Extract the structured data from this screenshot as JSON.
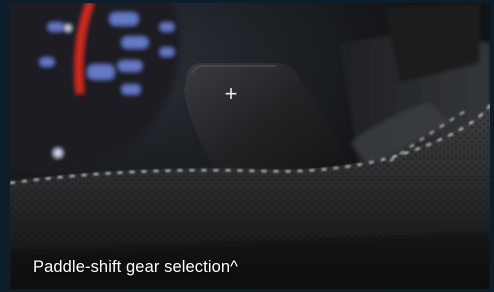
{
  "caption": "Paddle-shift gear selection^",
  "paddle_symbol": "+",
  "colors": {
    "frame_border": "#0d1e2a",
    "gauge_accent": "#d32a1e",
    "dial_numbers": "#7f97ff",
    "caption_text": "#ffffff"
  }
}
